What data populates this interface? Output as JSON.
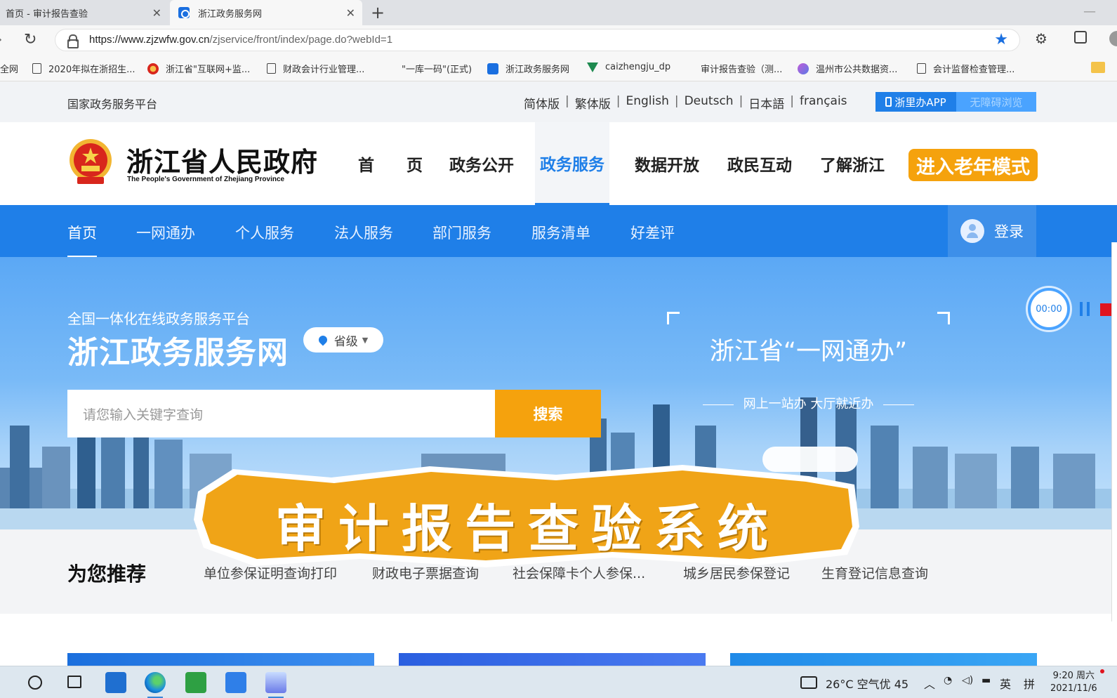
{
  "browser": {
    "tabs": [
      {
        "title": "首页 - 审计报告查验"
      },
      {
        "title": "浙江政务服务网"
      }
    ],
    "url_host": "https://www.zjzwfw.gov.cn",
    "url_path": "/zjservice/front/index/page.do?webId=1",
    "bookmarks": [
      "全网",
      "2020年拟在浙招生...",
      "浙江省\"互联网+监...",
      "财政会计行业管理...",
      "\"一库一码\"(正式)",
      "浙江政务服务网",
      "caizhengju_dp",
      "审计报告查验（测...",
      "温州市公共数据资...",
      "会计监督检查管理..."
    ]
  },
  "site": {
    "top": {
      "national_platform": "国家政务服务平台",
      "languages": [
        "简体版",
        "繁体版",
        "English",
        "Deutsch",
        "日本語",
        "français"
      ],
      "app_button": "浙里办APP",
      "a11y_button": "无障碍浏览"
    },
    "header": {
      "gov_name": "浙江省人民政府",
      "gov_name_en": "The People's Government of Zhejiang Province",
      "nav": [
        "首　　页",
        "政务公开",
        "政务服务",
        "数据开放",
        "政民互动",
        "了解浙江"
      ],
      "elder_mode": "进入老年模式"
    },
    "subnav": {
      "items": [
        "首页",
        "一网通办",
        "个人服务",
        "法人服务",
        "部门服务",
        "服务清单",
        "好差评"
      ],
      "login": "登录"
    },
    "hero": {
      "subtitle": "全国一体化在线政务服务平台",
      "title": "浙江政务服务网",
      "level": "省级",
      "search_placeholder": "请您输入关键字查询",
      "search_button": "搜索",
      "promo_title": "浙江省“一网通办”",
      "promo_subtitle": "网上一站办 大厅就近办"
    },
    "recommend": {
      "label": "为您推荐",
      "items": [
        "单位参保证明查询打印",
        "财政电子票据查询",
        "社会保障卡个人参保...",
        "城乡居民参保登记",
        "生育登记信息查询"
      ]
    }
  },
  "overlay": {
    "banner_text": "审计报告查验系统",
    "recorder_time": "00:00"
  },
  "taskbar": {
    "weather": "26°C 空气优 45",
    "ime_lang": "英",
    "ime_mode": "拼",
    "time": "9:20 周六",
    "date": "2021/11/6"
  },
  "colors": {
    "brand_blue": "#1f7fe8",
    "accent_orange": "#f5a20d"
  }
}
